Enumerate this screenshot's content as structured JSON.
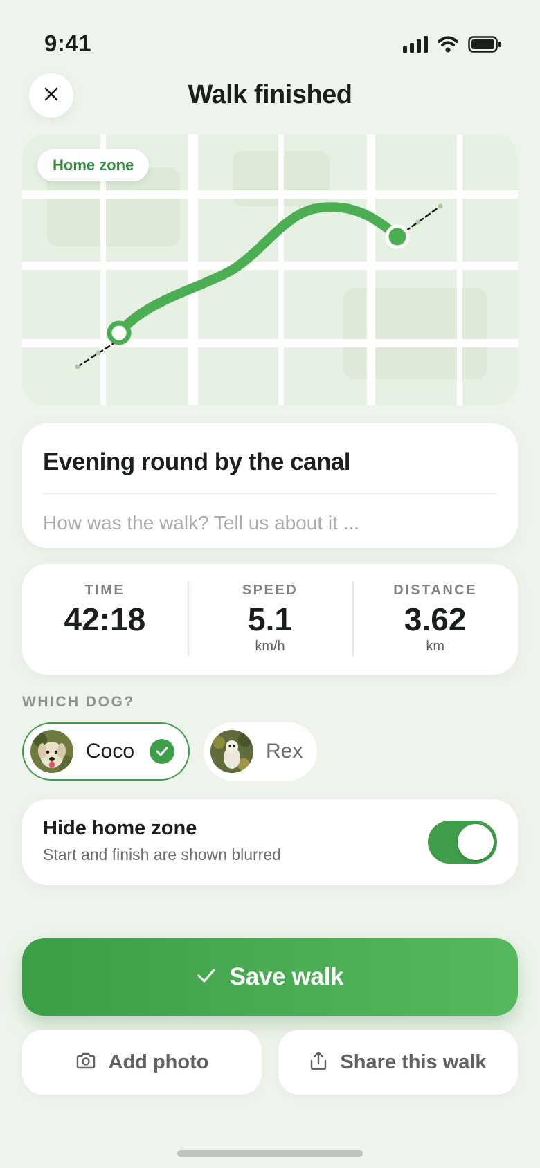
{
  "status_bar": {
    "time": "9:41"
  },
  "header": {
    "title": "Walk finished"
  },
  "map": {
    "home_zone_label": "Home zone"
  },
  "walk": {
    "title": "Evening round by the canal",
    "note_placeholder": "How was the walk? Tell us about it ...",
    "note_value": ""
  },
  "stats": [
    {
      "label": "TIME",
      "value": "42:18",
      "unit": ""
    },
    {
      "label": "SPEED",
      "value": "5.1",
      "unit": "km/h"
    },
    {
      "label": "DISTANCE",
      "value": "3.62",
      "unit": "km"
    }
  ],
  "dogs": {
    "section_label": "WHICH DOG?",
    "items": [
      {
        "name": "Coco",
        "selected": true
      },
      {
        "name": "Rex",
        "selected": false
      }
    ]
  },
  "privacy": {
    "title": "Hide home zone",
    "subtitle": "Start and finish are shown blurred",
    "enabled": true
  },
  "actions": {
    "save_label": "Save walk",
    "add_photo_label": "Add photo",
    "share_label": "Share this walk"
  },
  "colors": {
    "accent": "#3F9E4A",
    "background": "#EEF4EC",
    "map_base": "#E6F0E3"
  },
  "icons": [
    "close-icon",
    "signal-icon",
    "wifi-icon",
    "battery-icon",
    "check-icon",
    "camera-icon",
    "share-icon"
  ]
}
